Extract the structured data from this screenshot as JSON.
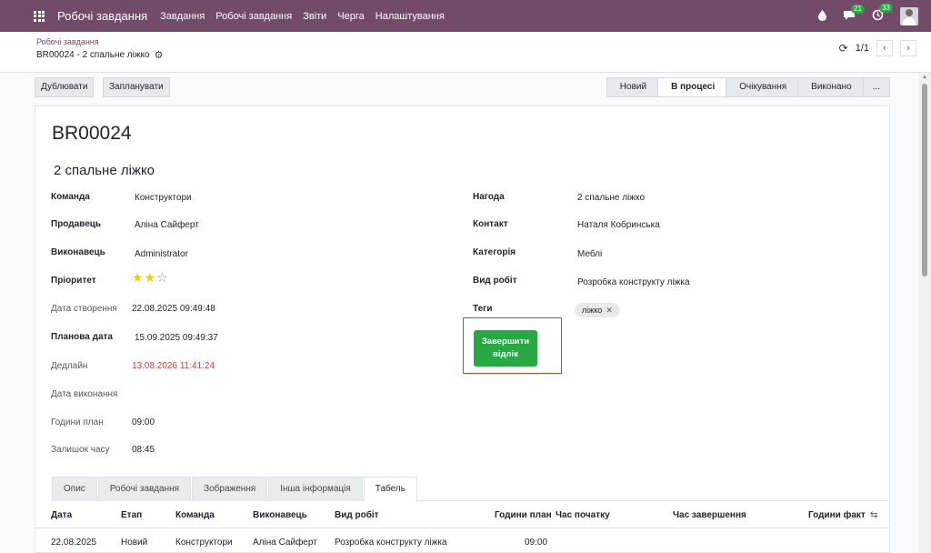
{
  "navbar": {
    "app_name": "Робочі завдання",
    "menu": [
      "Завдання",
      "Робочі завдання",
      "Звіти",
      "Черга",
      "Налаштування"
    ],
    "messages_count": "21",
    "activities_count": "33"
  },
  "breadcrumb": {
    "parent": "Робочі завдання",
    "current": "BR00024 - 2 спальне ліжко"
  },
  "pager": {
    "value": "1/1"
  },
  "actions": {
    "duplicate": "Дублювати",
    "schedule": "Запланувати"
  },
  "stages": [
    "Новий",
    "В процесі",
    "Очікування",
    "Виконано",
    "..."
  ],
  "active_stage": "В процесі",
  "record": {
    "code": "BR00024",
    "name": "2 спальне ліжко",
    "left": {
      "team_label": "Команда",
      "team": "Конструктори",
      "seller_label": "Продавець",
      "seller": "Аліна Сайферт",
      "executor_label": "Виконавець",
      "executor": "Administrator",
      "priority_label": "Пріоритет",
      "priority": "2 of 3 stars",
      "created_label": "Дата створення",
      "created": "22.08.2025 09:49:48",
      "planned_label": "Планова дата",
      "planned": "15.09.2025 09:49:37",
      "deadline_label": "Дедлайн",
      "deadline": "13.08.2026 11:41:24",
      "done_label": "Дата виконання",
      "hours_plan_label": "Години план",
      "hours_plan": "09:00",
      "hours_left_label": "Залишок часу",
      "hours_left": "08:45"
    },
    "right": {
      "opportunity_label": "Нагода",
      "opportunity": "2 спальне ліжко",
      "contact_label": "Контакт",
      "contact": "Наталя Кобринська",
      "category_label": "Категорія",
      "category": "Меблі",
      "work_type_label": "Вид робіт",
      "work_type": "Розробка конструкту ліжка",
      "tags_label": "Теги",
      "tag": "ліжко",
      "finish_button": "Завершити відлік"
    }
  },
  "colors": {
    "navbar": "#714b67",
    "accent_button": "#28a745",
    "deadline": "#d23f3a",
    "highlight_border": "#e53935"
  },
  "tabs": [
    "Опис",
    "Робочі завдання",
    "Зображення",
    "Інша інформація",
    "Табель"
  ],
  "active_tab": "Табель",
  "table": {
    "columns": [
      "Дата",
      "Етап",
      "Команда",
      "Виконавець",
      "Вид робіт",
      "Години план",
      "Час початку",
      "Час завершення",
      "Години факт"
    ],
    "rows": [
      [
        "22.08.2025",
        "Новий",
        "Конструктори",
        "Аліна Сайферт",
        "Розробка конструкту ліжка",
        "09:00",
        "",
        "",
        ""
      ]
    ]
  }
}
